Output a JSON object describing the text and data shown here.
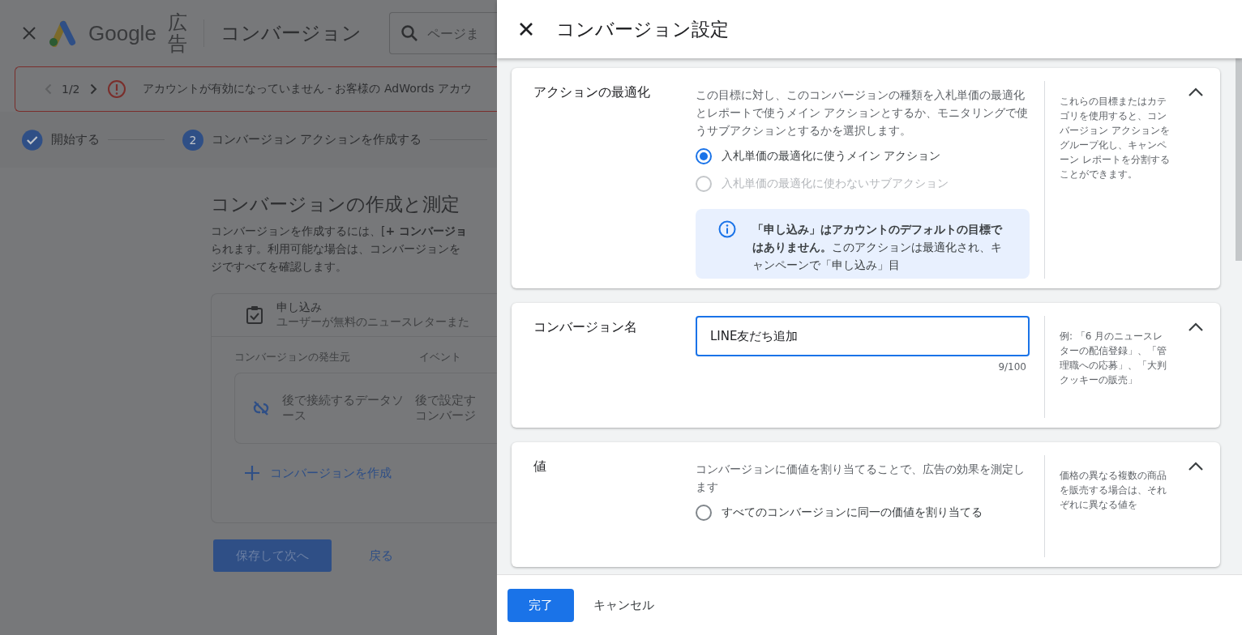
{
  "background_page": {
    "logo_text": "Google",
    "logo_suffix": "広告",
    "page_title": "コンバージョン",
    "search": {
      "placeholder": "ページま"
    },
    "alert": {
      "counter": "1/2",
      "message": "アカウントが有効になっていません - お客様の AdWords アカウ"
    },
    "steps": [
      {
        "label": "開始する",
        "completed": true
      },
      {
        "number": "2",
        "label": "コンバージョン アクションを作成する",
        "completed": false
      }
    ],
    "heading": "コンバージョンの作成と測定",
    "description": [
      "コンバージョンを作成するには、[**+ コンバージョ**",
      "られます。利用可能な場合は、コンバージョンを",
      "ジですべてを確認します。"
    ],
    "goal": {
      "title": "申し込み",
      "subtitle": "ユーザーが無料のニュースレターまた"
    },
    "columns": [
      "コンバージョンの発生元",
      "イベント"
    ],
    "source_row": {
      "source": "後で接続するデータソース",
      "event": "後で設定すコンバージ"
    },
    "create_link": "コンバージョンを作成",
    "buttons": [
      {
        "label": "保存して次へ",
        "kind": "primary"
      },
      {
        "label": "戻る",
        "kind": "text"
      }
    ]
  },
  "panel": {
    "title": "コンバージョン設定",
    "sections": [
      {
        "kind": "radios",
        "label": "アクションの最適化",
        "description": "この目標に対し、このコンバージョンの種類を入札単価の最適化とレポートで使うメイン アクションとするか、モニタリングで使うサブアクションとするかを選択します。",
        "options": [
          {
            "label": "入札単価の最適化に使うメイン アクション",
            "selected": true,
            "disabled": false
          },
          {
            "label": "入札単価の最適化に使わないサブアクション",
            "selected": false,
            "disabled": true
          }
        ],
        "notice": "**「申し込み」はアカウントのデフォルトの目標ではありません。**このアクションは最適化され、キャンペーンで「申し込み」目",
        "help": "これらの目標またはカテゴリを使用すると、コンバージョン アクションをグループ化し、キャンペーン レポートを分割することができます。",
        "expanded": true
      },
      {
        "kind": "text",
        "label": "コンバージョン名",
        "value": "LINE友だち追加",
        "counter": "9/100",
        "help": "例: 「6 月のニュースレターの配信登録」、「管理職への応募」、「大判クッキーの販売」",
        "expanded": true
      },
      {
        "kind": "radios",
        "label": "値",
        "description": "コンバージョンに価値を割り当てることで、広告の効果を測定します",
        "options": [
          {
            "label": "すべてのコンバージョンに同一の価値を割り当てる",
            "selected": false,
            "disabled": false
          }
        ],
        "help": "価格の異なる複数の商品を販売する場合は、それぞれに異なる値を",
        "expanded": true
      }
    ],
    "buttons": [
      {
        "label": "完了",
        "kind": "primary"
      },
      {
        "label": "キャンセル",
        "kind": "text"
      }
    ]
  }
}
